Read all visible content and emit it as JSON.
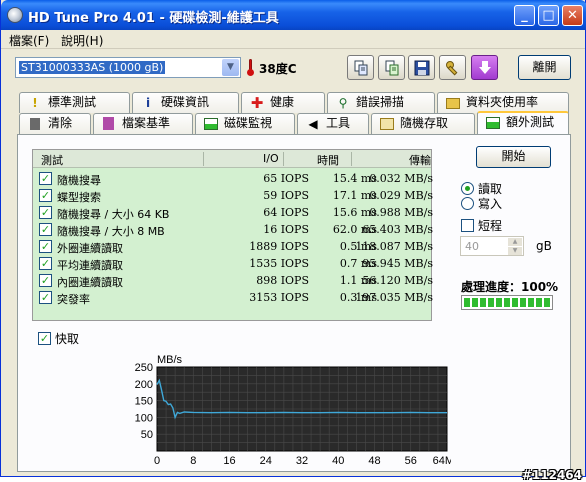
{
  "window": {
    "title": "HD Tune Pro 4.01 - 硬碟檢測-維護工具",
    "min_label": "_",
    "max_label": "□",
    "close_label": "✕"
  },
  "menu": {
    "items": [
      "檔案(F)",
      "說明(H)"
    ]
  },
  "toolbar": {
    "drive": "ST31000333AS (1000 gB)",
    "temperature": "38度C",
    "exit_label": "離開"
  },
  "tabs_top": [
    {
      "label": "標準測試",
      "icon": "exclamation-icon"
    },
    {
      "label": "硬碟資訊",
      "icon": "info-icon"
    },
    {
      "label": "健康",
      "icon": "red-cross-icon"
    },
    {
      "label": "錯誤掃描",
      "icon": "magnifier-icon"
    },
    {
      "label": "資料夾使用率",
      "icon": "folder-icon"
    }
  ],
  "tabs_bottom": [
    {
      "label": "清除",
      "icon": "trash-icon"
    },
    {
      "label": "檔案基準",
      "icon": "file-benchmark-icon"
    },
    {
      "label": "磁碟監視",
      "icon": "monitor-chart-icon"
    },
    {
      "label": "工具",
      "icon": "speaker-icon"
    },
    {
      "label": "隨機存取",
      "icon": "random-access-icon"
    },
    {
      "label": "額外測試",
      "icon": "extra-tests-icon"
    }
  ],
  "active_tab": "額外測試",
  "results": {
    "headers": {
      "test": "測試",
      "io": "I/O",
      "time": "時間",
      "rate": "傳輸"
    },
    "rows": [
      {
        "name": "隨機搜尋",
        "io": "65 IOPS",
        "time": "15.4 ms",
        "rate": "0.032 MB/s",
        "checked": true
      },
      {
        "name": "蝶型搜索",
        "io": "59 IOPS",
        "time": "17.1 ms",
        "rate": "0.029 MB/s",
        "checked": true
      },
      {
        "name": "隨機搜尋 / 大小 64 KB",
        "io": "64 IOPS",
        "time": "15.6 ms",
        "rate": "0.988 MB/s",
        "checked": true
      },
      {
        "name": "隨機搜尋 / 大小 8 MB",
        "io": "16 IOPS",
        "time": "62.0 ms",
        "rate": "65.403 MB/s",
        "checked": true
      },
      {
        "name": "外圈連續讀取",
        "io": "1889 IOPS",
        "time": "0.5 ms",
        "rate": "118.087 MB/s",
        "checked": true
      },
      {
        "name": "平均連續讀取",
        "io": "1535 IOPS",
        "time": "0.7 ms",
        "rate": "95.945 MB/s",
        "checked": true
      },
      {
        "name": "內圈連續讀取",
        "io": "898 IOPS",
        "time": "1.1 ms",
        "rate": "56.120 MB/s",
        "checked": true
      },
      {
        "name": "突發率",
        "io": "3153 IOPS",
        "time": "0.3 ms",
        "rate": "197.035 MB/s",
        "checked": true
      }
    ]
  },
  "controls": {
    "start_label": "開始",
    "read_label": "讀取",
    "write_label": "寫入",
    "mode": "read",
    "short_label": "短程",
    "short_checked": false,
    "short_value": "40",
    "short_unit": "gB",
    "progress_label": "處理進度：100%",
    "progress": 1.0,
    "cache_label": "快取",
    "cache_checked": true
  },
  "chart_data": {
    "type": "line",
    "ylabel": "MB/s",
    "ylim": [
      0,
      250
    ],
    "yticks": [
      50,
      100,
      150,
      200,
      250
    ],
    "xticks": [
      "0",
      "8",
      "16",
      "24",
      "32",
      "40",
      "48",
      "56",
      "64MB"
    ],
    "xlim": [
      0,
      64
    ],
    "grid": true,
    "series": [
      {
        "color": "#3fa8d8",
        "x": [
          0,
          0.5,
          1,
          1.5,
          2,
          2.5,
          3,
          3.5,
          4,
          4.5,
          5,
          6,
          8,
          12,
          16,
          20,
          24,
          28,
          32,
          36,
          40,
          44,
          48,
          52,
          56,
          60,
          64
        ],
        "y": [
          198,
          210,
          182,
          150,
          148,
          138,
          140,
          128,
          100,
          115,
          112,
          116,
          115,
          114,
          115,
          114,
          114,
          115,
          114,
          114,
          115,
          114,
          114,
          114,
          115,
          114,
          114
        ]
      }
    ]
  },
  "watermark": "#112464",
  "colors": {
    "results_bg": "#d3f0d0",
    "title_bar": "#0a5ee8",
    "line": "#3fa8d8",
    "plot_bg": "#2a2a2a",
    "check": "#21a121"
  }
}
